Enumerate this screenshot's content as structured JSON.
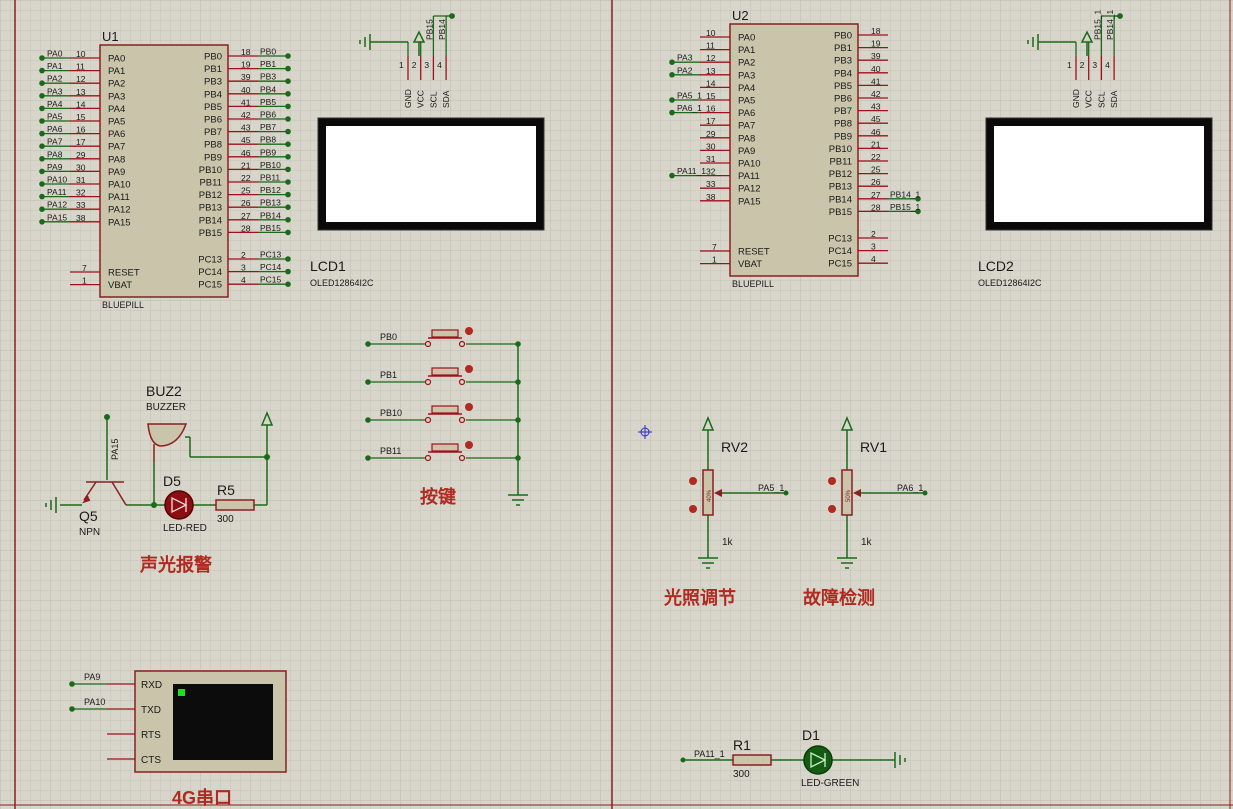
{
  "u1": {
    "ref": "U1",
    "model": "BLUEPILL",
    "left_pins": [
      {
        "num": "10",
        "name": "PA0",
        "net": "PA0"
      },
      {
        "num": "11",
        "name": "PA1",
        "net": "PA1"
      },
      {
        "num": "12",
        "name": "PA2",
        "net": "PA2"
      },
      {
        "num": "13",
        "name": "PA3",
        "net": "PA3"
      },
      {
        "num": "14",
        "name": "PA4",
        "net": "PA4"
      },
      {
        "num": "15",
        "name": "PA5",
        "net": "PA5"
      },
      {
        "num": "16",
        "name": "PA6",
        "net": "PA6"
      },
      {
        "num": "17",
        "name": "PA7",
        "net": "PA7"
      },
      {
        "num": "29",
        "name": "PA8",
        "net": "PA8"
      },
      {
        "num": "30",
        "name": "PA9",
        "net": "PA9"
      },
      {
        "num": "31",
        "name": "PA10",
        "net": "PA10"
      },
      {
        "num": "32",
        "name": "PA11",
        "net": "PA11"
      },
      {
        "num": "33",
        "name": "PA12",
        "net": "PA12"
      },
      {
        "num": "38",
        "name": "PA15",
        "net": "PA15"
      }
    ],
    "left_bottom_pins": [
      {
        "num": "7",
        "name": "RESET"
      },
      {
        "num": "1",
        "name": "VBAT"
      }
    ],
    "right_pins": [
      {
        "num": "18",
        "name": "PB0",
        "net": "PB0"
      },
      {
        "num": "19",
        "name": "PB1",
        "net": "PB1"
      },
      {
        "num": "39",
        "name": "PB3",
        "net": "PB3"
      },
      {
        "num": "40",
        "name": "PB4",
        "net": "PB4"
      },
      {
        "num": "41",
        "name": "PB5",
        "net": "PB5"
      },
      {
        "num": "42",
        "name": "PB6",
        "net": "PB6"
      },
      {
        "num": "43",
        "name": "PB7",
        "net": "PB7"
      },
      {
        "num": "45",
        "name": "PB8",
        "net": "PB8"
      },
      {
        "num": "46",
        "name": "PB9",
        "net": "PB9"
      },
      {
        "num": "21",
        "name": "PB10",
        "net": "PB10"
      },
      {
        "num": "22",
        "name": "PB11",
        "net": "PB11"
      },
      {
        "num": "25",
        "name": "PB12",
        "net": "PB12"
      },
      {
        "num": "26",
        "name": "PB13",
        "net": "PB13"
      },
      {
        "num": "27",
        "name": "PB14",
        "net": "PB14"
      },
      {
        "num": "28",
        "name": "PB15",
        "net": "PB15"
      }
    ],
    "right_bottom_pins": [
      {
        "num": "2",
        "name": "PC13",
        "net": "PC13"
      },
      {
        "num": "3",
        "name": "PC14",
        "net": "PC14"
      },
      {
        "num": "4",
        "name": "PC15",
        "net": "PC15"
      }
    ]
  },
  "u2": {
    "ref": "U2",
    "model": "BLUEPILL",
    "left_pins": [
      {
        "num": "10",
        "name": "PA0",
        "net": ""
      },
      {
        "num": "11",
        "name": "PA1",
        "net": ""
      },
      {
        "num": "12",
        "name": "PA2",
        "net": "PA3"
      },
      {
        "num": "13",
        "name": "PA3",
        "net": "PA2"
      },
      {
        "num": "14",
        "name": "PA4",
        "net": ""
      },
      {
        "num": "15",
        "name": "PA5",
        "net": "PA5_1"
      },
      {
        "num": "16",
        "name": "PA6",
        "net": "PA6_1"
      },
      {
        "num": "17",
        "name": "PA7",
        "net": ""
      },
      {
        "num": "29",
        "name": "PA8",
        "net": ""
      },
      {
        "num": "30",
        "name": "PA9",
        "net": ""
      },
      {
        "num": "31",
        "name": "PA10",
        "net": ""
      },
      {
        "num": "32",
        "name": "PA11",
        "net": "PA11_1"
      },
      {
        "num": "33",
        "name": "PA12",
        "net": ""
      },
      {
        "num": "38",
        "name": "PA15",
        "net": ""
      }
    ],
    "left_bottom_pins": [
      {
        "num": "7",
        "name": "RESET"
      },
      {
        "num": "1",
        "name": "VBAT"
      }
    ],
    "right_pins": [
      {
        "num": "18",
        "name": "PB0",
        "net": ""
      },
      {
        "num": "19",
        "name": "PB1",
        "net": ""
      },
      {
        "num": "39",
        "name": "PB3",
        "net": ""
      },
      {
        "num": "40",
        "name": "PB4",
        "net": ""
      },
      {
        "num": "41",
        "name": "PB5",
        "net": ""
      },
      {
        "num": "42",
        "name": "PB6",
        "net": ""
      },
      {
        "num": "43",
        "name": "PB7",
        "net": ""
      },
      {
        "num": "45",
        "name": "PB8",
        "net": ""
      },
      {
        "num": "46",
        "name": "PB9",
        "net": ""
      },
      {
        "num": "21",
        "name": "PB10",
        "net": ""
      },
      {
        "num": "22",
        "name": "PB11",
        "net": ""
      },
      {
        "num": "25",
        "name": "PB12",
        "net": ""
      },
      {
        "num": "26",
        "name": "PB13",
        "net": ""
      },
      {
        "num": "27",
        "name": "PB14",
        "net": "PB14_1"
      },
      {
        "num": "28",
        "name": "PB15",
        "net": "PB15_1"
      }
    ],
    "right_bottom_pins": [
      {
        "num": "2",
        "name": "PC13",
        "net": ""
      },
      {
        "num": "3",
        "name": "PC14",
        "net": ""
      },
      {
        "num": "4",
        "name": "PC15",
        "net": ""
      }
    ]
  },
  "lcd1": {
    "ref": "LCD1",
    "model": "OLED12864I2C",
    "pins": [
      {
        "num": "1",
        "name": "GND",
        "net": ""
      },
      {
        "num": "2",
        "name": "VCC",
        "net": ""
      },
      {
        "num": "3",
        "name": "SCL",
        "net": "PB15"
      },
      {
        "num": "4",
        "name": "SDA",
        "net": "PB14"
      }
    ]
  },
  "lcd2": {
    "ref": "LCD2",
    "model": "OLED12864I2C",
    "pins": [
      {
        "num": "1",
        "name": "GND",
        "net": ""
      },
      {
        "num": "2",
        "name": "VCC",
        "net": ""
      },
      {
        "num": "3",
        "name": "SCL",
        "net": "PB15_1"
      },
      {
        "num": "4",
        "name": "SDA",
        "net": "PB14_1"
      }
    ]
  },
  "alarm": {
    "title": "声光报警",
    "buzzer_ref": "BUZ2",
    "buzzer_value": "BUZZER",
    "transistor_ref": "Q5",
    "transistor_value": "NPN",
    "base_net": "PA15",
    "led_ref": "D5",
    "led_value": "LED-RED",
    "resistor_ref": "R5",
    "resistor_value": "300"
  },
  "keys": {
    "title": "按键",
    "nets": [
      "PB0",
      "PB1",
      "PB10",
      "PB11"
    ]
  },
  "light": {
    "title": "光照调节",
    "ref": "RV2",
    "value": "1k",
    "wiper_net": "PA5_1",
    "position": "40%"
  },
  "fault": {
    "title": "故障检测",
    "ref": "RV1",
    "value": "1k",
    "wiper_net": "PA6_1",
    "position": "50%"
  },
  "uart": {
    "title": "4G串口",
    "pins": [
      {
        "name": "RXD",
        "net": "PA9"
      },
      {
        "name": "TXD",
        "net": "PA10"
      },
      {
        "name": "RTS",
        "net": ""
      },
      {
        "name": "CTS",
        "net": ""
      }
    ]
  },
  "status_led": {
    "resistor_ref": "R1",
    "resistor_value": "300",
    "led_ref": "D1",
    "led_value": "LED-GREEN",
    "net": "PA11_1"
  },
  "colors": {
    "background": "#d8d6ca",
    "grid": "#c6c4b8",
    "body_fill": "#c9c4aa",
    "pin_red": "#a0101a",
    "wire_green": "#1a6a1a",
    "title_red": "#b02a22",
    "text_dark": "#1a1a1a",
    "border_red": "#8a2020"
  }
}
